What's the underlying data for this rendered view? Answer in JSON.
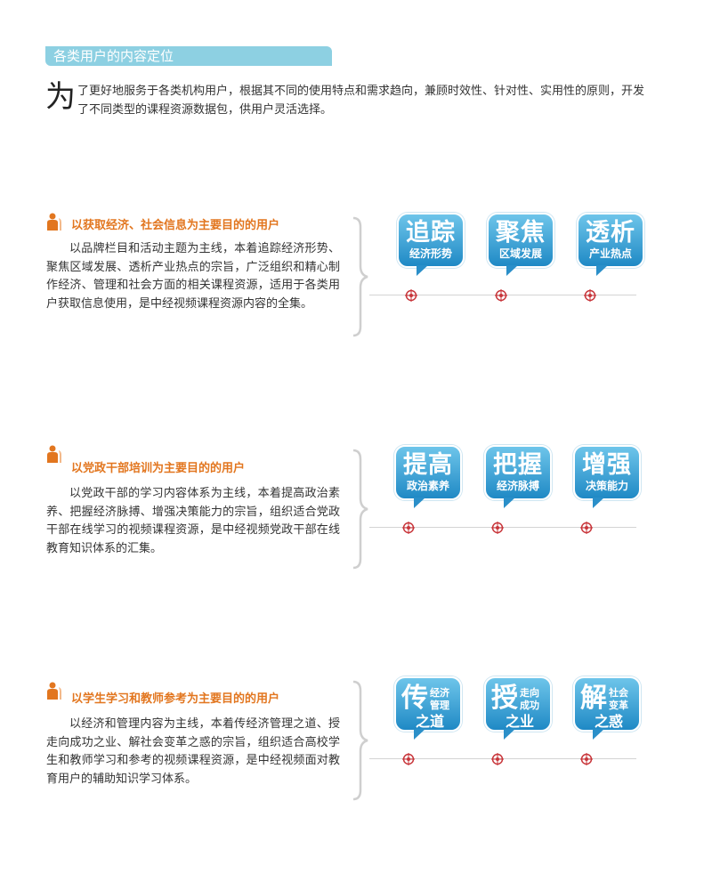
{
  "header": {
    "title": "各类用户的内容定位"
  },
  "intro": {
    "dropcap": "为",
    "text": "了更好地服务于各类机构用户，根据其不同的使用特点和需求趋向，兼顾时效性、针对性、实用性的原则，开发了不同类型的课程资源数据包，供用户灵活选择。"
  },
  "sections": [
    {
      "title": "以获取经济、社会信息为主要目的的用户",
      "body": "以品牌栏目和活动主题为主线，本着追踪经济形势、聚焦区域发展、透析产业热点的宗旨，广泛组织和精心制作经济、管理和社会方面的相关课程资源，适用于各类用户获取信息使用，是中经视频课程资源内容的全集。",
      "cards": [
        {
          "big": "追踪",
          "small": "经济形势"
        },
        {
          "big": "聚焦",
          "small": "区域发展"
        },
        {
          "big": "透析",
          "small": "产业热点"
        }
      ]
    },
    {
      "title": "以党政干部培训为主要目的的用户",
      "body": "以党政干部的学习内容体系为主线，本着提高政治素养、把握经济脉搏、增强决策能力的宗旨，组织适合党政干部在线学习的视频课程资源，是中经视频党政干部在线教育知识体系的汇集。",
      "cards": [
        {
          "big": "提高",
          "small": "政治素养"
        },
        {
          "big": "把握",
          "small": "经济脉搏"
        },
        {
          "big": "增强",
          "small": "决策能力"
        }
      ]
    },
    {
      "title": "以学生学习和教师参考为主要目的的用户",
      "body": "以经济和管理内容为主线，本着传经济管理之道、授走向成功之业、解社会变革之惑的宗旨，组织适合高校学生和教师学习和参考的视频课程资源，是中经视频面对教育用户的辅助知识学习体系。",
      "cards": [
        {
          "big": "传",
          "right1": "经济",
          "right2": "管理",
          "bottom": "之道"
        },
        {
          "big": "授",
          "right1": "走向",
          "right2": "成功",
          "bottom": "之业"
        },
        {
          "big": "解",
          "right1": "社会",
          "right2": "变革",
          "bottom": "之惑"
        }
      ]
    }
  ],
  "colors": {
    "accent": "#e2761f",
    "title_bar": "#8dd0e2",
    "card_top": "#6ec5ea",
    "card_bottom": "#1f89c5",
    "target": "#c8353a"
  }
}
